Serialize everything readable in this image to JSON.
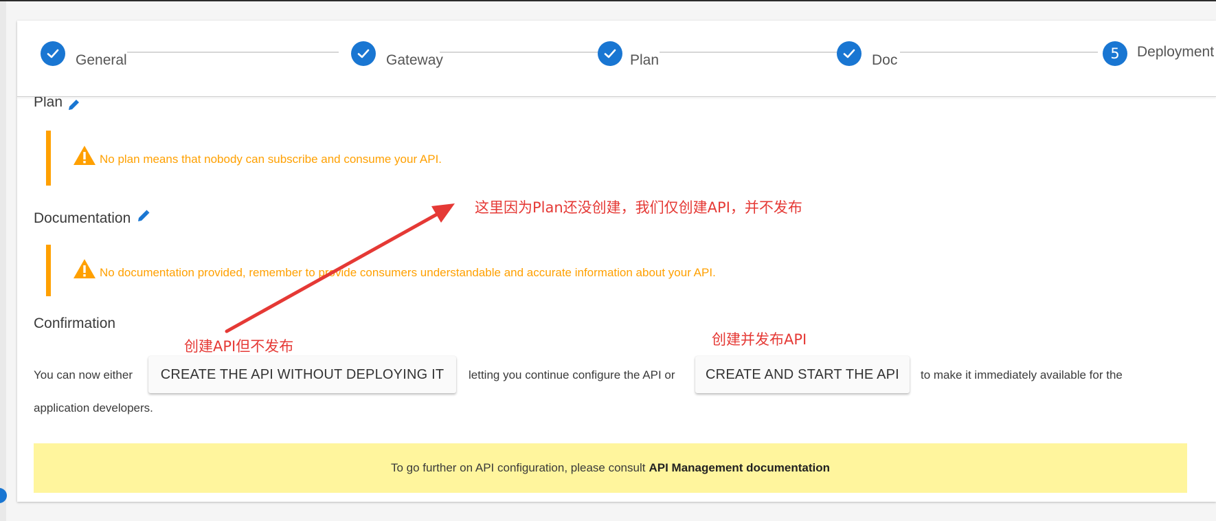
{
  "stepper": {
    "steps": [
      {
        "label": "General",
        "state": "done",
        "icon": "check-icon"
      },
      {
        "label": "Gateway",
        "state": "done",
        "icon": "check-icon"
      },
      {
        "label": "Plan",
        "state": "done",
        "icon": "check-icon"
      },
      {
        "label": "Doc",
        "state": "done",
        "icon": "check-icon"
      },
      {
        "label": "Deployment",
        "state": "active",
        "number": "5"
      }
    ]
  },
  "sections": {
    "plan_title_partial": "Plan",
    "plan_warning": "No plan means that nobody can subscribe and consume your API.",
    "documentation_title": "Documentation",
    "documentation_warning": "No documentation provided, remember to provide consumers understandable and accurate information about your API.",
    "confirmation_title": "Confirmation"
  },
  "confirmation": {
    "text_before": "You can now either",
    "create_button": "CREATE THE API WITHOUT DEPLOYING IT",
    "text_middle": "letting you continue configure the API or",
    "create_start_button": "CREATE AND START THE API",
    "text_after": "to make it immediately available for the",
    "text_line2": "application developers."
  },
  "banner": {
    "text": "To go further on API configuration, please consult",
    "link": "API Management documentation"
  },
  "annotations": {
    "top_note": "这里因为Plan还没创建，我们仅创建API，并不发布",
    "left_note": "创建API但不发布",
    "right_note": "创建并发布API"
  },
  "colors": {
    "primary": "#1976d2",
    "warning": "#ffa000",
    "banner": "#fff59d",
    "annotation": "#e53935"
  }
}
